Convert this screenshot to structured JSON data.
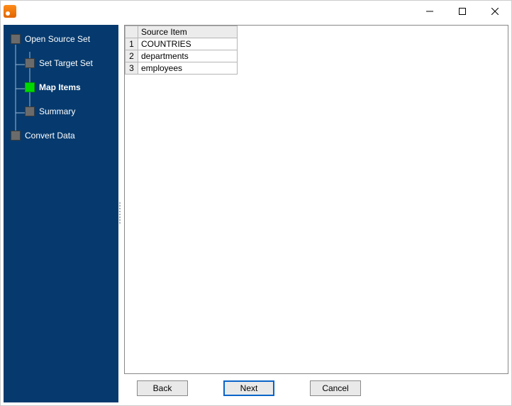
{
  "window": {
    "title": ""
  },
  "sidebar": {
    "items": [
      {
        "label": "Open Source Set",
        "level": 0,
        "active": false
      },
      {
        "label": "Set Target Set",
        "level": 1,
        "active": false
      },
      {
        "label": "Map Items",
        "level": 1,
        "active": true
      },
      {
        "label": "Summary",
        "level": 1,
        "active": false
      },
      {
        "label": "Convert Data",
        "level": 0,
        "active": false
      }
    ]
  },
  "table": {
    "header": "Source Item",
    "rows": [
      {
        "n": "1",
        "item": "COUNTRIES"
      },
      {
        "n": "2",
        "item": "departments"
      },
      {
        "n": "3",
        "item": "employees"
      }
    ]
  },
  "buttons": {
    "back": "Back",
    "next": "Next",
    "cancel": "Cancel"
  }
}
